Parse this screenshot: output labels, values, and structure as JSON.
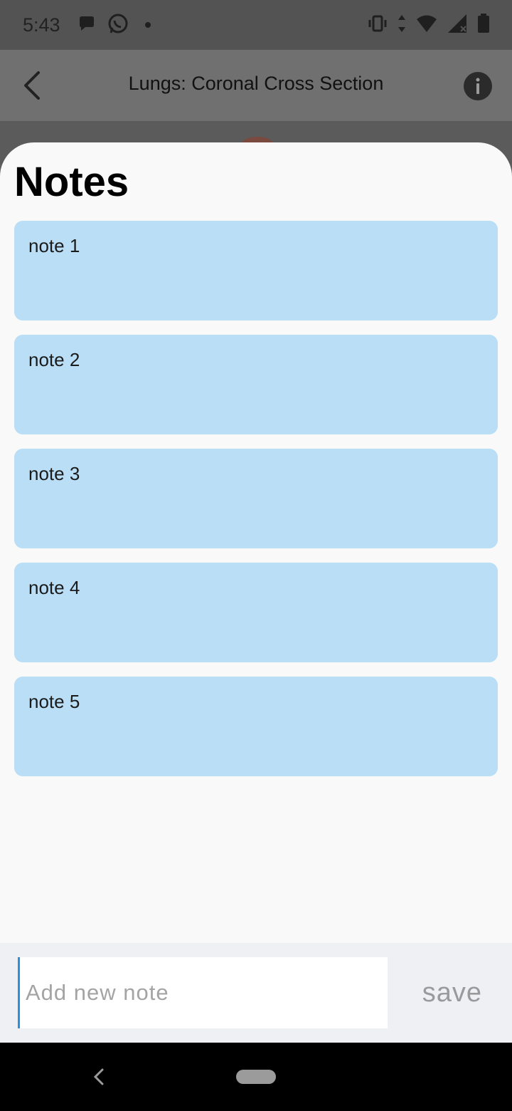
{
  "status_bar": {
    "time": "5:43",
    "left_icons": [
      "message-bubble-icon",
      "whatsapp-icon",
      "dot-icon"
    ],
    "right_icons": [
      "vibrate-icon",
      "data-arrows-icon",
      "wifi-icon",
      "signal-icon",
      "battery-icon"
    ]
  },
  "app_bar": {
    "title": "Lungs: Coronal Cross Section",
    "back_icon": "chevron-left-icon",
    "info_icon": "info-icon"
  },
  "sheet": {
    "title": "Notes",
    "notes": [
      "note 1",
      "note 2",
      "note 3",
      "note 4",
      "note 5"
    ]
  },
  "input_bar": {
    "placeholder": "Add new note",
    "value": "",
    "save_label": "save"
  },
  "colors": {
    "note_card": "#b9def6",
    "sheet_bg": "#f9f9f9",
    "input_bar_bg": "#eff0f4",
    "cursor": "#2d8fe0"
  }
}
